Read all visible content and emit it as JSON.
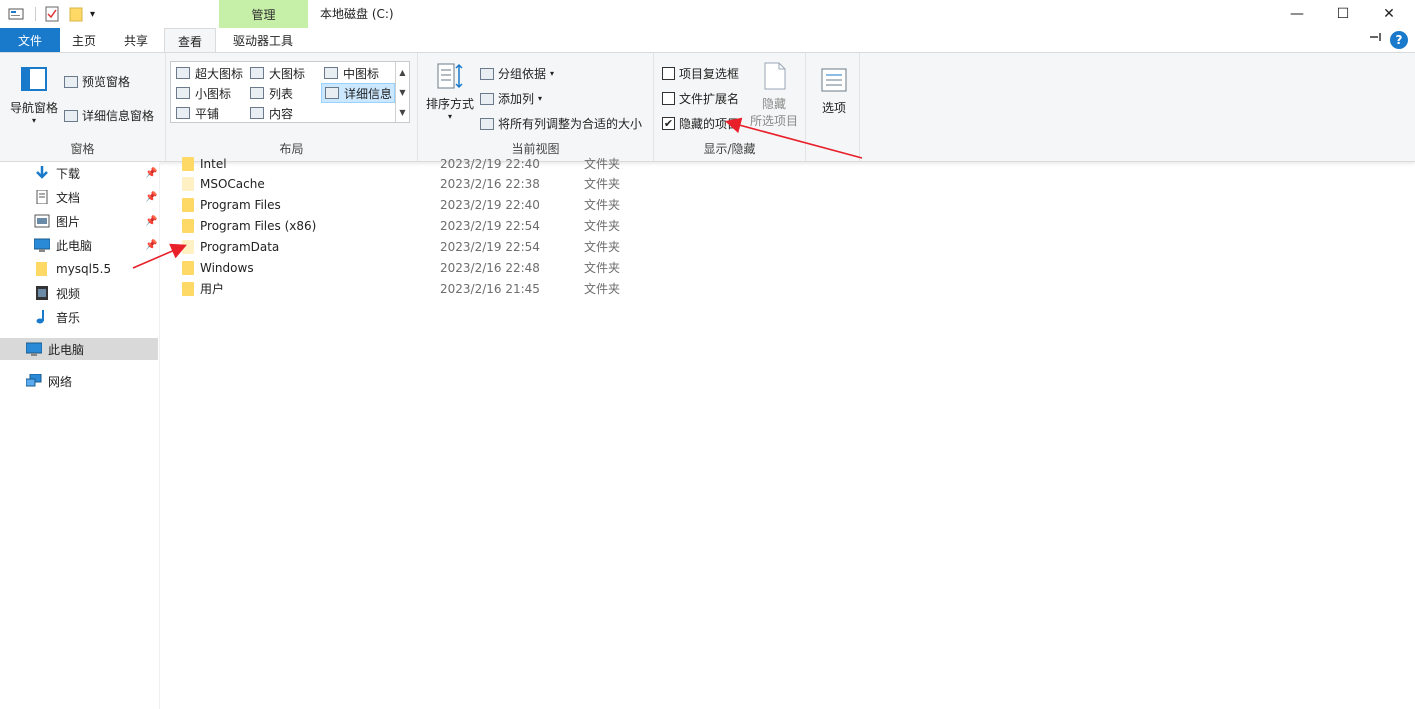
{
  "window": {
    "title": "本地磁盘 (C:)",
    "context_tab": "管理",
    "controls": {
      "minimize": "—",
      "maximize": "☐",
      "close": "✕"
    }
  },
  "tabs": {
    "file": "文件",
    "home": "主页",
    "share": "共享",
    "view": "查看",
    "drive_tools": "驱动器工具",
    "expand_glyph": "✓",
    "help": "?"
  },
  "ribbon": {
    "panes": {
      "label": "窗格",
      "nav_pane": "导航窗格",
      "preview_pane": "预览窗格",
      "details_pane": "详细信息窗格"
    },
    "layout": {
      "label": "布局",
      "items": [
        "超大图标",
        "大图标",
        "中图标",
        "小图标",
        "列表",
        "详细信息",
        "平铺",
        "内容"
      ],
      "selected": "详细信息"
    },
    "current_view": {
      "label": "当前视图",
      "sort_by": "排序方式",
      "group_by": "分组依据",
      "add_columns": "添加列",
      "size_all_columns": "将所有列调整为合适的大小"
    },
    "show_hide": {
      "label": "显示/隐藏",
      "item_checkboxes": "项目复选框",
      "item_checkboxes_checked": false,
      "file_extensions": "文件扩展名",
      "file_extensions_checked": false,
      "hidden_items": "隐藏的项目",
      "hidden_items_checked": true,
      "hide_selected_line1": "隐藏",
      "hide_selected_line2": "所选项目"
    },
    "options": "选项"
  },
  "nav": {
    "quick_access": [
      {
        "label": "下载",
        "icon": "download-icon",
        "pinned": true
      },
      {
        "label": "文档",
        "icon": "document-icon",
        "pinned": true
      },
      {
        "label": "图片",
        "icon": "picture-icon",
        "pinned": true
      },
      {
        "label": "此电脑",
        "icon": "computer-icon",
        "pinned": true
      },
      {
        "label": "mysql5.5",
        "icon": "folder-icon",
        "pinned": false
      },
      {
        "label": "视频",
        "icon": "video-icon",
        "pinned": false
      },
      {
        "label": "音乐",
        "icon": "music-icon",
        "pinned": false
      }
    ],
    "this_pc": "此电脑",
    "network": "网络"
  },
  "files": [
    {
      "name": "Intel",
      "date": "2023/2/19 22:40",
      "type": "文件夹",
      "hidden": false
    },
    {
      "name": "MSOCache",
      "date": "2023/2/16 22:38",
      "type": "文件夹",
      "hidden": true
    },
    {
      "name": "Program Files",
      "date": "2023/2/19 22:40",
      "type": "文件夹",
      "hidden": false
    },
    {
      "name": "Program Files (x86)",
      "date": "2023/2/19 22:54",
      "type": "文件夹",
      "hidden": false
    },
    {
      "name": "ProgramData",
      "date": "2023/2/19 22:54",
      "type": "文件夹",
      "hidden": true
    },
    {
      "name": "Windows",
      "date": "2023/2/16 22:48",
      "type": "文件夹",
      "hidden": false
    },
    {
      "name": "用户",
      "date": "2023/2/16 21:45",
      "type": "文件夹",
      "hidden": false
    }
  ],
  "colors": {
    "file_tab": "#1979ca",
    "manage_tab": "#c6efa7",
    "annotation_arrow": "#e8202a",
    "folder": "#ffd966"
  }
}
